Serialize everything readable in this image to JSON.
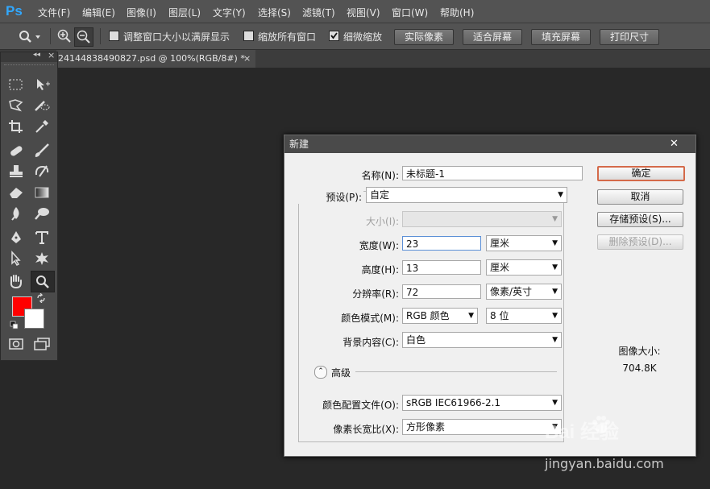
{
  "app": {
    "logo": "Ps"
  },
  "menu": [
    "文件(F)",
    "编辑(E)",
    "图像(I)",
    "图层(L)",
    "文字(Y)",
    "选择(S)",
    "滤镜(T)",
    "视图(V)",
    "窗口(W)",
    "帮助(H)"
  ],
  "options": {
    "resize_windows_label": "调整窗口大小以满屏显示",
    "zoom_all_label": "缩放所有窗口",
    "scrubby_zoom_label": "细微缩放",
    "actual_pixels": "实际像素",
    "fit_screen": "适合屏幕",
    "fill_screen": "填充屏幕",
    "print_size": "打印尺寸"
  },
  "document_tab": {
    "title": "24144838490827.psd @ 100%(RGB/8#) *",
    "close": "×"
  },
  "toolbox": {
    "collapse": "◂◂",
    "close": "×",
    "foreground": "#ff0000",
    "background": "#ffffff"
  },
  "dialog": {
    "title": "新建",
    "close": "✕",
    "name_label": "名称(N):",
    "name_value": "未标题-1",
    "preset_label": "预设(P):",
    "preset_value": "自定",
    "size_label": "大小(I):",
    "size_value": "",
    "width_label": "宽度(W):",
    "width_value": "23",
    "width_unit": "厘米",
    "height_label": "高度(H):",
    "height_value": "13",
    "height_unit": "厘米",
    "resolution_label": "分辨率(R):",
    "resolution_value": "72",
    "resolution_unit": "像素/英寸",
    "color_mode_label": "颜色模式(M):",
    "color_mode_value": "RGB 颜色",
    "bit_depth": "8 位",
    "background_label": "背景内容(C):",
    "background_value": "白色",
    "advanced_label": "高级",
    "color_profile_label": "颜色配置文件(O):",
    "color_profile_value": "sRGB IEC61966-2.1",
    "pixel_aspect_label": "像素长宽比(X):",
    "pixel_aspect_value": "方形像素",
    "ok": "确定",
    "cancel": "取消",
    "save_preset": "存储预设(S)...",
    "delete_preset": "删除预设(D)...",
    "image_size_label": "图像大小:",
    "image_size_value": "704.8K"
  },
  "watermark": {
    "brand": "Bai 经验",
    "url": "jingyan.baidu.com"
  }
}
